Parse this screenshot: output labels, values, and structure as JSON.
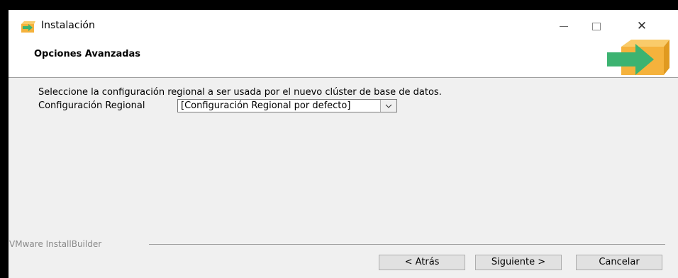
{
  "window": {
    "title": "Instalación",
    "controls": {
      "minimize_icon": "minimize-icon",
      "maximize_icon": "maximize-icon",
      "close_icon": "close-icon"
    }
  },
  "header": {
    "heading": "Opciones Avanzadas",
    "logo_icon": "installer-box-arrow-icon"
  },
  "body": {
    "description": "Seleccione la configuración regional a ser usada por el nuevo clúster de base de datos.",
    "locale_label": "Configuración Regional",
    "locale_value": "[Configuración Regional por defecto]"
  },
  "footer": {
    "brand": "VMware InstallBuilder",
    "back_label": "< Atrás",
    "next_label": "Siguiente >",
    "cancel_label": "Cancelar"
  },
  "colors": {
    "window_bg": "#f0f0f0",
    "header_bg": "#ffffff",
    "box_orange": "#f5b23c",
    "arrow_green": "#3cb371"
  }
}
